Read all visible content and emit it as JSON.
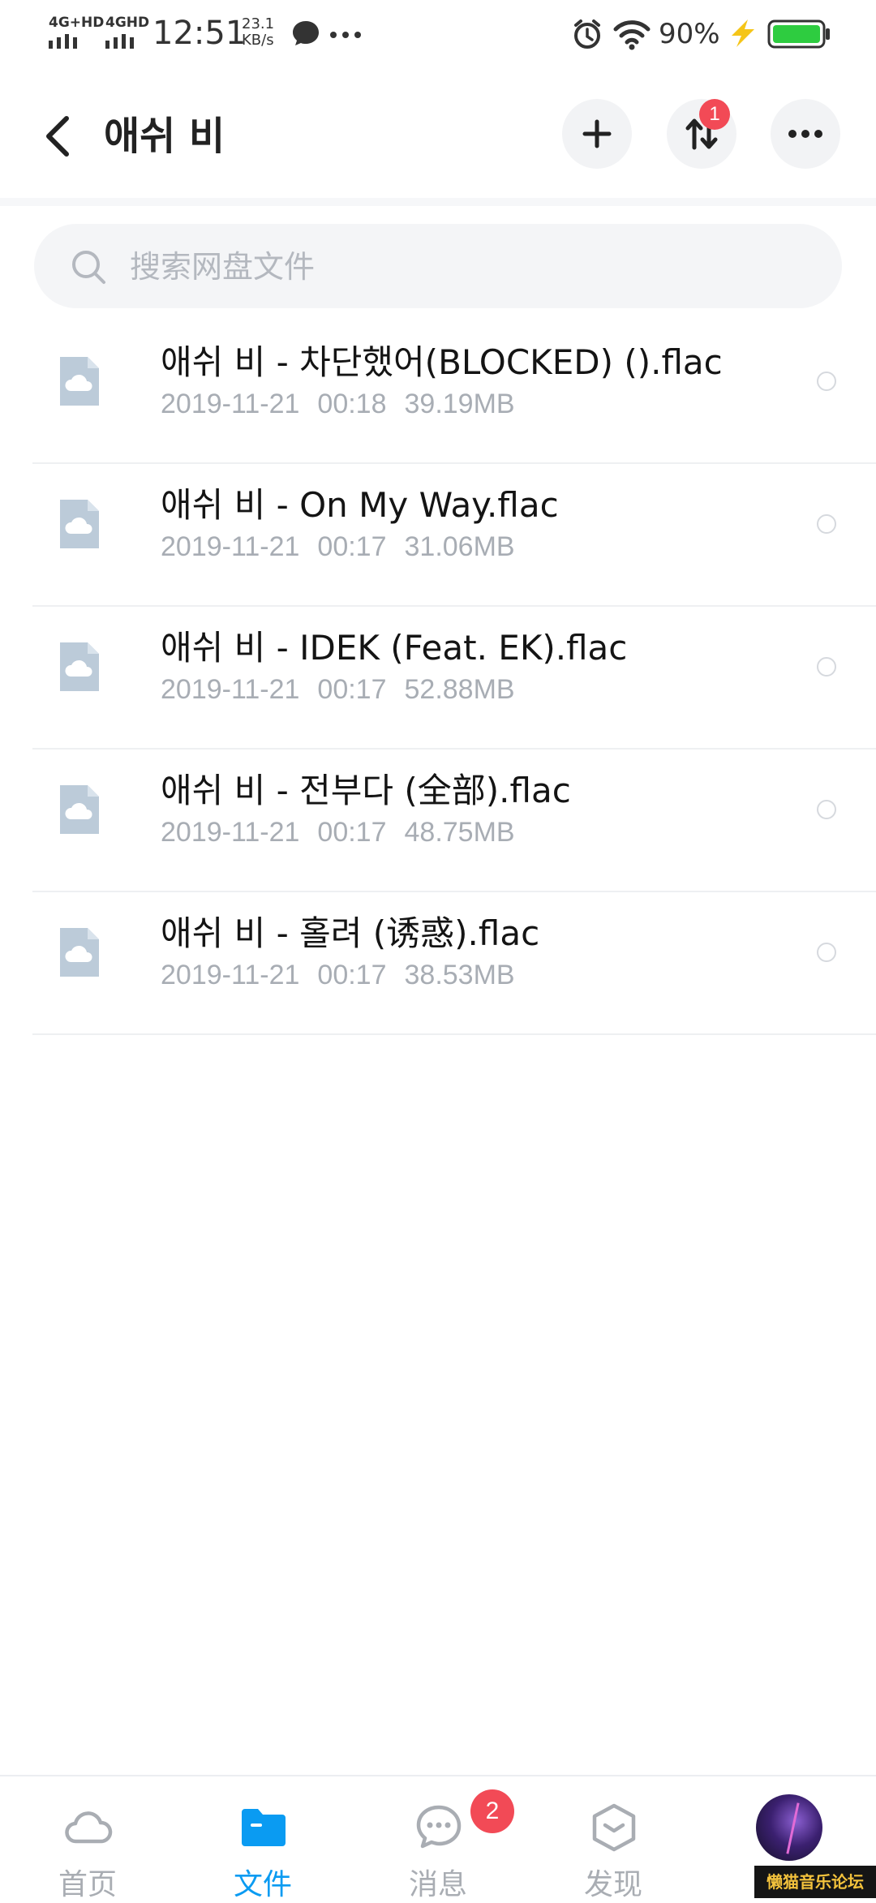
{
  "status_bar": {
    "network1": "4G+HD",
    "network2": "4GHD",
    "time": "12:51",
    "speed_value": "23.1",
    "speed_unit": "KB/s",
    "battery_percent": "90%"
  },
  "header": {
    "title": "애쉬 비",
    "transfer_badge": "1"
  },
  "search": {
    "placeholder": "搜索网盘文件"
  },
  "files": [
    {
      "name": "애쉬 비 - 차단했어(BLOCKED) ().flac",
      "date": "2019-11-21",
      "time": "00:18",
      "size": "39.19MB"
    },
    {
      "name": "애쉬 비 - On My Way.flac",
      "date": "2019-11-21",
      "time": "00:17",
      "size": "31.06MB"
    },
    {
      "name": "애쉬 비 - IDEK (Feat. EK).flac",
      "date": "2019-11-21",
      "time": "00:17",
      "size": "52.88MB"
    },
    {
      "name": "애쉬 비 - 전부다 (全部).flac",
      "date": "2019-11-21",
      "time": "00:17",
      "size": "48.75MB"
    },
    {
      "name": "애쉬 비 - 홀려 (诱惑).flac",
      "date": "2019-11-21",
      "time": "00:17",
      "size": "38.53MB"
    }
  ],
  "bottom_nav": {
    "items": [
      {
        "label": "首页",
        "icon": "cloud-icon"
      },
      {
        "label": "文件",
        "icon": "folder-icon",
        "active": true
      },
      {
        "label": "消息",
        "icon": "chat-icon",
        "badge": "2"
      },
      {
        "label": "发现",
        "icon": "discover-icon"
      },
      {
        "label": "",
        "icon": "avatar"
      }
    ]
  },
  "watermark": "懒猫音乐论坛",
  "colors": {
    "accent": "#0a9bf2",
    "badge": "#f24a56",
    "battery": "#2ecc40",
    "charging": "#f5c518"
  }
}
